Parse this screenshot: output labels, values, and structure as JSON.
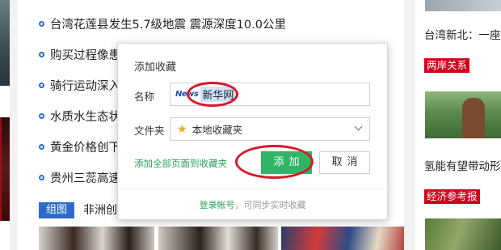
{
  "news": {
    "items": [
      "台湾花莲县发生5.7级地震 震源深度10.0公里",
      "购买过程像患",
      "骑行运动深入",
      "水质水生态状",
      "黄金价格创下",
      "贵州三蕊高速"
    ],
    "gallery_tag": "组图",
    "gallery_caption": "非洲创"
  },
  "right_column": {
    "headline_1": "台湾新北：一座",
    "tag_1": "两岸关系",
    "headline_2": "氢能有望带动形",
    "tag_2": "经济参考报"
  },
  "dialog": {
    "title": "添加收藏",
    "name_label": "名称",
    "site_logo": "News",
    "name_value": "新华网",
    "folder_label": "文件夹",
    "folder_value": "本地收藏夹",
    "add_all_link": "添加全部页面到收藏夹",
    "add_button": "添加",
    "cancel_button": "取消",
    "footer_link": "登录帐号",
    "footer_text": "，可同步实时收藏"
  },
  "colors": {
    "accent_green": "#2fb565",
    "annotation_red": "#d9182a",
    "news_blue": "#2f6cc9",
    "tag_red": "#d0021b"
  }
}
